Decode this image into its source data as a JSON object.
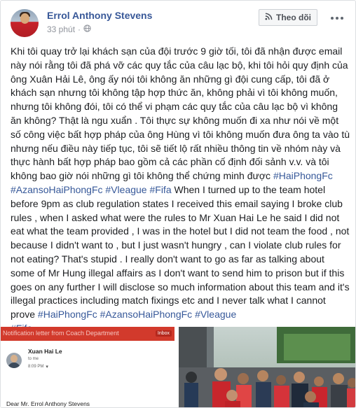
{
  "post": {
    "author": "Errol Anthony Stevens",
    "time": "33 phút",
    "separator": "·",
    "follow_label": "Theo dõi",
    "body_vi": "Khi tôi quay trở lại khách sạn của đội trước 9 giờ tối, tôi đã nhận được email này nói rằng tôi đã phá vỡ các quy tắc của câu lạc bộ, khi tôi hỏi quy định của ông Xuân Hải Lê, ông ấy nói tôi không ăn những gì đội cung cấp, tôi đã ở khách sạn nhưng tôi không tập hợp thức ăn, không phải vì tôi không muốn, nhưng tôi không đói, tôi có thể vi phạm các quy tắc của câu lạc bộ vì không ăn không? Thật là ngu xuẩn . Tôi thực sự không muốn đi xa như nói về một số công việc bất hợp pháp của ông Hùng vì tôi không muốn đưa ông ta vào tù nhưng nếu điều này tiếp tục, tôi sẽ tiết lộ rất nhiều thông tin về nhóm này và thực hành bất hợp pháp bao gồm cả các phần cố định đối sảnh v.v. và tôi không bao giờ nói những gì tôi không thể chứng minh được ",
    "hashtags_vi": [
      "#HaiPhongFc",
      "#AzansoHaiPhongFc",
      "#Vleague",
      "#Fifa"
    ],
    "body_en": " When I turned up to the team hotel before 9pm as club regulation states I received this email saying I broke club rules , when I asked what were the rules to Mr Xuan Hai Le he said I did not eat what the team provided , I was in the hotel but I did not team the food , not because I didn't want to , but I just wasn't hungry , can I violate club rules for not eating? That's stupid . I really don't want to go as far as talking about some of Mr Hung illegal affairs as I don't want to send him to prison but if this goes on any further I will disclose so much information about this team and it's illegal practices including match fixings etc and I never talk what I cannot prove ",
    "hashtags_en": [
      "#HaiPhongFc",
      "#AzansoHaiPhongFc",
      "#Vleague",
      "#Fifa"
    ]
  },
  "photo_email": {
    "topbar_text": "Notification letter from Coach Department",
    "inbox_label": "Inbox",
    "from_name": "Xuan Hai Le",
    "to_line": "to me",
    "time": "8:09 PM",
    "time_arrow": "▾",
    "greeting": "Dear Mr. Errol Anthony Stevens"
  },
  "colors": {
    "link": "#385898",
    "hashtag": "#365899",
    "meta": "#90949c",
    "email_bar": "#d23a2c"
  },
  "icons": {
    "privacy": "globe-icon",
    "follow": "rss-icon",
    "more": "more-icon"
  }
}
